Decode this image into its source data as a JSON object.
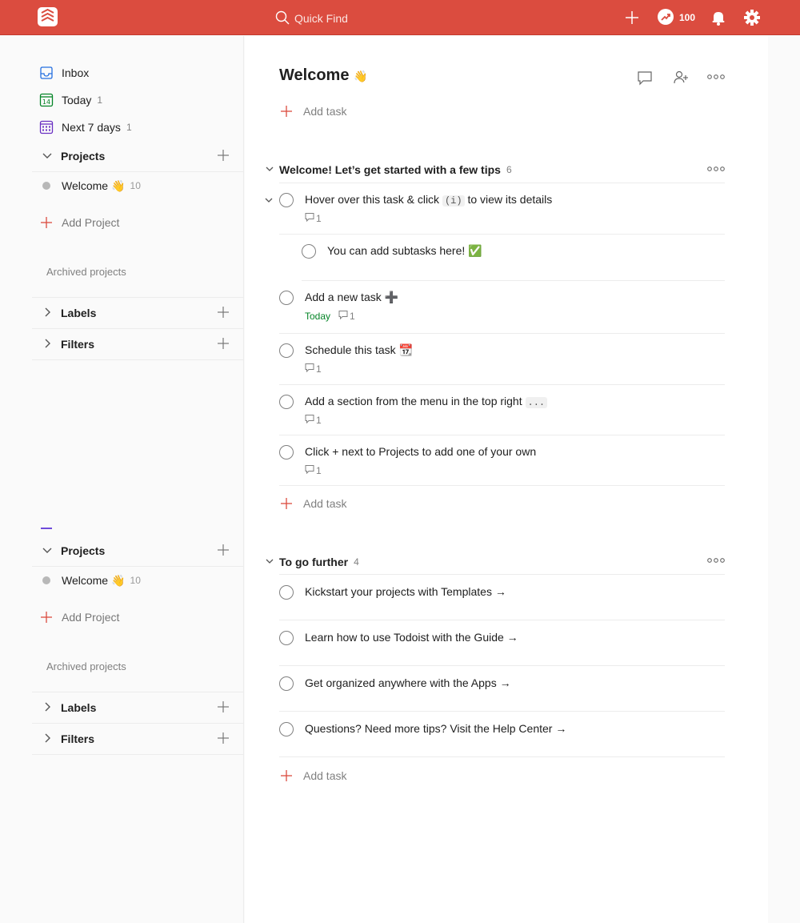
{
  "topbar": {
    "search_placeholder": "Quick Find",
    "karma": "100",
    "icons": [
      "todoist-logo-icon",
      "search-icon",
      "add-icon",
      "karma-icon",
      "bell-icon",
      "gear-icon"
    ]
  },
  "sidebar": {
    "nav": [
      {
        "label": "Inbox",
        "count": ""
      },
      {
        "label": "Today",
        "count": "1"
      },
      {
        "label": "Next 7 days",
        "count": "1"
      }
    ],
    "today_icon_num": "14",
    "projects_label": "Projects",
    "projects": [
      {
        "label": "Welcome",
        "emoji": "👋",
        "count": "10"
      }
    ],
    "add_project": "Add Project",
    "archived": "Archived projects",
    "labels": "Labels",
    "filters": "Filters"
  },
  "main": {
    "title": "Welcome",
    "title_emoji": "👋",
    "add_task": "Add task",
    "sections": [
      {
        "title": "Welcome! Let’s get started with a few tips",
        "count": "6",
        "tasks": [
          {
            "content": "Hover over this task & click",
            "code": "(i)",
            "content_after": "to view its details",
            "comments": "1"
          },
          {
            "content": "You can add subtasks here!",
            "emoji": "✅"
          },
          {
            "content": "Add a new task",
            "emoji": "➕",
            "due": "Today",
            "comments": "1"
          },
          {
            "content": "Schedule this task",
            "emoji": "📆",
            "comments": "1"
          },
          {
            "content": "Add a section from the menu in the top right",
            "code": "...",
            "comments": "1"
          },
          {
            "content": "Click + next to Projects to add one of your own",
            "comments": "1"
          }
        ]
      },
      {
        "title": "To go further",
        "count": "4",
        "tasks": [
          {
            "content": "Kickstart your projects with Templates →"
          },
          {
            "content": "Learn how to use Todoist with the Guide →"
          },
          {
            "content": "Get organized anywhere with the Apps →"
          },
          {
            "content": "Questions? Need more tips? Visit the Help Center →"
          }
        ]
      }
    ]
  },
  "colors": {
    "brand": "#db4c3f",
    "due_today": "#058527",
    "upcoming": "#692fc2",
    "inbox": "#246fe0"
  }
}
